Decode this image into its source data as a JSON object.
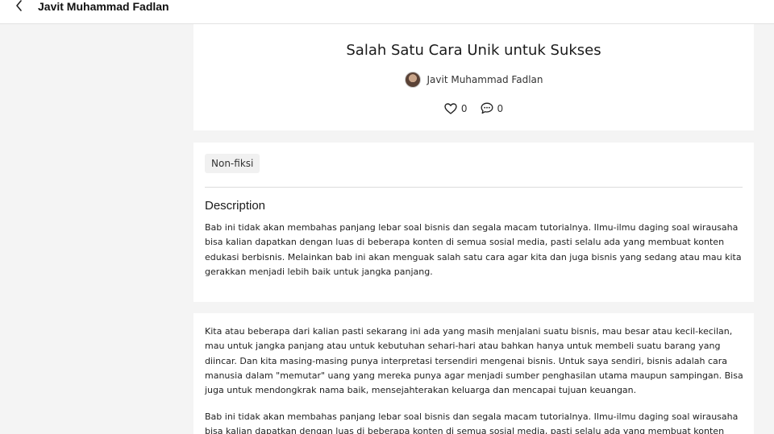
{
  "topbar": {
    "back_icon": "chevron-left-icon",
    "author_title": "Javit Muhammad Fadlan"
  },
  "story": {
    "title": "Salah Satu Cara Unik untuk Sukses",
    "author": "Javit Muhammad Fadlan",
    "likes": "0",
    "comments": "0",
    "like_icon": "heart-icon",
    "comment_icon": "comment-icon"
  },
  "details": {
    "tag": "Non-fiksi",
    "description_heading": "Description",
    "description_text": "Bab ini tidak akan membahas panjang lebar soal bisnis dan segala macam tutorialnya. Ilmu-ilmu daging soal wirausaha bisa kalian dapatkan dengan luas di beberapa konten di semua sosial media, pasti selalu ada yang membuat konten edukasi berbisnis. Melainkan bab ini akan menguak salah satu cara agar kita dan juga bisnis yang sedang atau mau kita gerakkan menjadi lebih baik untuk jangka panjang."
  },
  "content": {
    "paragraphs": [
      "Kita atau beberapa dari kalian pasti sekarang ini ada yang masih menjalani suatu bisnis, mau besar atau kecil-kecilan, mau untuk jangka panjang atau untuk kebutuhan sehari-hari atau bahkan hanya untuk membeli suatu barang yang diincar. Dan kita masing-masing punya interpretasi tersendiri mengenai bisnis. Untuk saya sendiri, bisnis adalah cara manusia dalam \"memutar\" uang yang mereka punya agar menjadi sumber penghasilan utama maupun sampingan. Bisa juga untuk mendongkrak nama baik, mensejahterakan keluarga dan mencapai tujuan keuangan.",
      "Bab ini tidak akan membahas panjang lebar soal bisnis dan segala macam tutorialnya. Ilmu-ilmu daging soal wirausaha bisa kalian dapatkan dengan luas di beberapa konten di semua sosial media, pasti selalu ada yang membuat konten edukasi"
    ]
  }
}
